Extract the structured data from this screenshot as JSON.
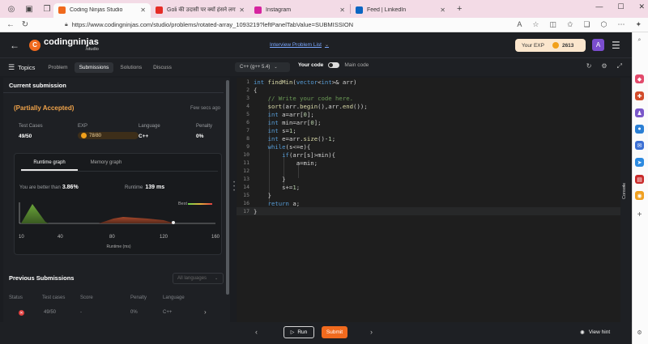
{
  "browser": {
    "tabs": [
      {
        "title": "Coding Ninjas Studio",
        "active": true,
        "color": "#f06a1e"
      },
      {
        "title": "Goli की उदासी पर क्यों हंसने लगा ये",
        "active": false,
        "color": "#e52d27"
      },
      {
        "title": "Instagram",
        "active": false,
        "color": "#d6249f"
      },
      {
        "title": "Feed | LinkedIn",
        "active": false,
        "color": "#0a66c2"
      }
    ],
    "new_tab": "+",
    "url": "https://www.codingninjas.com/studio/problems/rotated-array_1093219?leftPanelTabValue=SUBMISSION"
  },
  "header": {
    "logo_main": "codingninjas",
    "logo_sub": "/studio",
    "problem_list": "Interview Problem List",
    "exp_label": "Your EXP",
    "exp_value": "2613",
    "avatar_letter": "A"
  },
  "subbar": {
    "topics": "Topics",
    "tabs": [
      "Problem",
      "Submissions",
      "Solutions",
      "Discuss"
    ],
    "active_tab": "Submissions",
    "language": "C++ (g++ 5.4)",
    "your_code": "Your code",
    "main_code": "Main code"
  },
  "submission": {
    "title": "Current submission",
    "status": "(Partially Accepted)",
    "time": "Few secs ago",
    "stats": {
      "test_cases_label": "Test Cases",
      "test_cases_value": "49/50",
      "exp_label": "EXP",
      "exp_value": "78/80",
      "language_label": "Language",
      "language_value": "C++",
      "penalty_label": "Penalty",
      "penalty_value": "0%"
    },
    "graph_tabs": [
      "Runtime graph",
      "Memory graph"
    ],
    "better_label": "You are better than",
    "better_value": "3.86%",
    "runtime_label": "Runtime",
    "runtime_value": "139 ms",
    "best_label": "Best",
    "x_ticks": [
      "10",
      "40",
      "80",
      "120",
      "160"
    ],
    "x_label": "Runtime (ms)"
  },
  "previous": {
    "title": "Previous Submissions",
    "filter": "All languages",
    "headers": [
      "Status",
      "Test cases",
      "Score",
      "Penalty",
      "Language"
    ],
    "rows": [
      {
        "test_cases": "49/50",
        "score": "-",
        "penalty": "0%",
        "language": "C++"
      }
    ]
  },
  "code_lines": [
    "int findMin(vector<int>& arr)",
    "{",
    "    // Write your code here.",
    "    sort(arr.begin(),arr.end());",
    "    int a=arr[0];",
    "    int min=arr[0];",
    "    int s=1;",
    "    int e=arr.size()-1;",
    "    while(s<=e){",
    "        if(arr[s]>min){",
    "            a=min;",
    "",
    "        }",
    "        s+=1;",
    "    }",
    "    return a;",
    "}"
  ],
  "console_label": "Console",
  "bottom": {
    "run": "Run",
    "submit": "Submit",
    "view_hint": "View hint"
  }
}
